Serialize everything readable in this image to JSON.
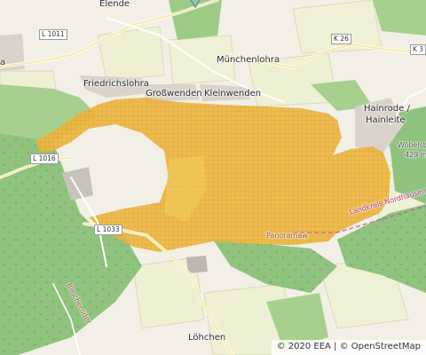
{
  "map": {
    "places": {
      "elende": "Elende",
      "friedrichslohra": "Friedrichslohra",
      "grosswenden": "Großwenden",
      "kleinwenden": "Kleinwenden",
      "muenchenlohra": "Münchenlohra",
      "hainrode_line1": "Hainrode /",
      "hainrode_line2": "Hainleite",
      "woebelsburg_line1": "Wöbelsb",
      "woebelsburg_line2": "429 m",
      "loehchen": "Löhchen",
      "west_edge": "a"
    },
    "roads": {
      "l1011": "L 1011",
      "k26": "K 26",
      "k3": "K 3",
      "l1016": "L 1016",
      "l1033": "L 1033"
    },
    "boundary_label": "Landkreis Nordhausen",
    "path_label": "Bleicheroder",
    "trail_label": "Panoramaw",
    "attribution": {
      "eea": "© 2020 EEA",
      "separator": "|",
      "osm": "© OpenStreetMap"
    },
    "colors": {
      "overlay_fill": "#f0b43c",
      "overlay_hatch": "#b89a2e",
      "forest": "#8fc37e",
      "farmland": "#eef0d4",
      "background": "#f2efe6",
      "boundary": "#c65fa0"
    }
  }
}
